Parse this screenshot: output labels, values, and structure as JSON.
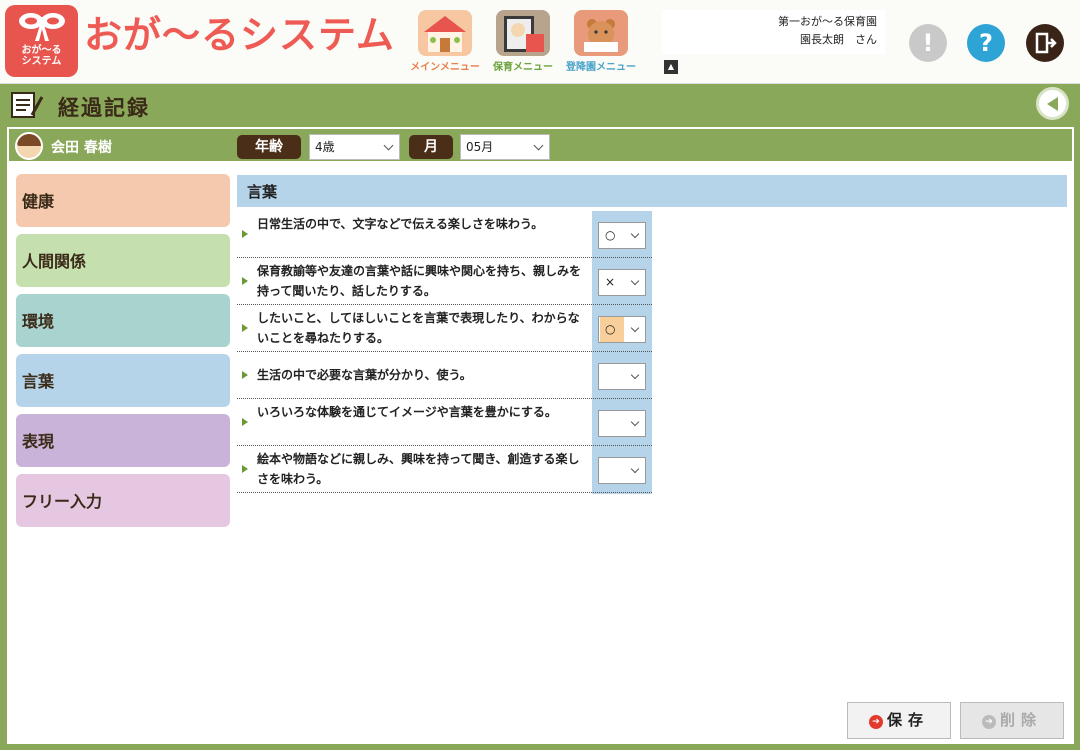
{
  "app": {
    "logo_text_1": "おが～る",
    "logo_text_2": "システム",
    "title": "おが～るシステム"
  },
  "menus": {
    "main": "メインメニュー",
    "care": "保育メニュー",
    "attendance": "登降園メニュー"
  },
  "user": {
    "facility": "第一おが～る保育園",
    "name": "園長太朗　さん"
  },
  "header_icons": {
    "alert": "!",
    "help": "?"
  },
  "page": {
    "title": "経過記録"
  },
  "child": {
    "name": "会田 春樹"
  },
  "filters": {
    "age_label": "年齢",
    "age_value": "4歳",
    "month_label": "月",
    "month_value": "05月"
  },
  "categories": [
    {
      "label": "健康",
      "color": "#f4c9ad"
    },
    {
      "label": "人間関係",
      "color": "#c6dfae"
    },
    {
      "label": "環境",
      "color": "#a9d3cf"
    },
    {
      "label": "言葉",
      "color": "#b5d4ea"
    },
    {
      "label": "表現",
      "color": "#c9b3d8"
    },
    {
      "label": "フリー入力",
      "color": "#e5c7e2"
    }
  ],
  "section": {
    "title": "言葉",
    "items": [
      {
        "text": "日常生活の中で、文字などで伝える楽しさを味わう。",
        "value": "○"
      },
      {
        "text": "保育教諭等や友達の言葉や話に興味や関心を持ち、親しみを持って聞いたり、話したりする。",
        "value": "×"
      },
      {
        "text": "したいこと、してほしいことを言葉で表現したり、わからないことを尋ねたりする。",
        "value": "○"
      },
      {
        "text": "生活の中で必要な言葉が分かり、使う。",
        "value": ""
      },
      {
        "text": "いろいろな体験を通じてイメージや言葉を豊かにする。",
        "value": ""
      },
      {
        "text": "絵本や物語などに親しみ、興味を持って聞き、創造する楽しさを味わう。",
        "value": ""
      }
    ]
  },
  "buttons": {
    "save": "保存",
    "delete": "削除"
  }
}
